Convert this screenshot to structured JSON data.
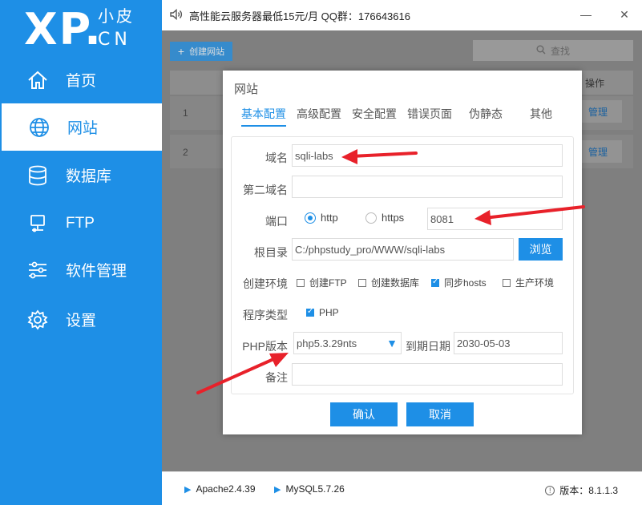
{
  "logo": {
    "big": "XP.",
    "small": "小皮",
    "cn": "CN"
  },
  "sidebar": {
    "items": [
      {
        "label": "首页",
        "icon": "home-icon"
      },
      {
        "label": "网站",
        "icon": "globe-icon",
        "active": true
      },
      {
        "label": "数据库",
        "icon": "database-icon"
      },
      {
        "label": "FTP",
        "icon": "monitor-icon"
      },
      {
        "label": "软件管理",
        "icon": "sliders-icon"
      },
      {
        "label": "设置",
        "icon": "gear-icon"
      }
    ]
  },
  "topbar": {
    "notice": "高性能云服务器最低15元/月   QQ群：176643616"
  },
  "toolbar": {
    "create_label": "创建网站",
    "search_label": "查找"
  },
  "table": {
    "op_header": "操作",
    "rows": [
      {
        "num": "1",
        "manage": "管理"
      },
      {
        "num": "2",
        "manage": "管理"
      }
    ]
  },
  "dialog": {
    "title": "网站",
    "tabs": [
      "基本配置",
      "高级配置",
      "安全配置",
      "错误页面",
      "伪静态",
      "其他"
    ],
    "labels": {
      "domain": "域名",
      "second_domain": "第二域名",
      "port": "端口",
      "root": "根目录",
      "env": "创建环境",
      "prog_type": "程序类型",
      "php_ver": "PHP版本",
      "expire": "到期日期",
      "remark": "备注"
    },
    "values": {
      "domain": "sqli-labs",
      "second_domain": "",
      "port": "8081",
      "root": "C:/phpstudy_pro/WWW/sqli-labs",
      "php_ver": "php5.3.29nts",
      "expire": "2030-05-03",
      "remark": ""
    },
    "protocol_options": [
      {
        "label": "http",
        "selected": true
      },
      {
        "label": "https",
        "selected": false
      }
    ],
    "browse_label": "浏览",
    "env_options": [
      {
        "label": "创建FTP",
        "checked": false
      },
      {
        "label": "创建数据库",
        "checked": false
      },
      {
        "label": "同步hosts",
        "checked": true
      },
      {
        "label": "生产环境",
        "checked": false
      }
    ],
    "prog_options": [
      {
        "label": "PHP",
        "checked": true
      }
    ],
    "confirm_label": "确认",
    "cancel_label": "取消"
  },
  "footer": {
    "services": [
      "Apache2.4.39",
      "MySQL5.7.26"
    ],
    "version": "版本：8.1.1.3"
  },
  "colors": {
    "accent": "#1e8fe6",
    "annotation": "#e8212a"
  }
}
